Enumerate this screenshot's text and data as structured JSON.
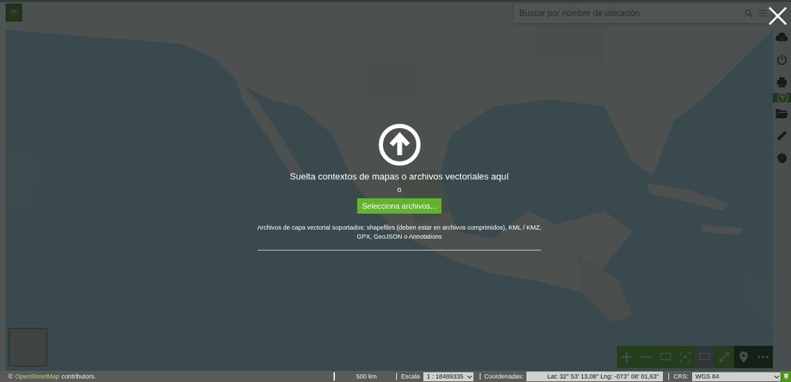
{
  "search": {
    "placeholder": "Buscar por nombre de ubicación"
  },
  "sidebar": {
    "items": [
      {
        "kind": "cloud",
        "selected": false
      },
      {
        "kind": "power",
        "selected": false
      },
      {
        "kind": "print",
        "selected": false
      },
      {
        "kind": "upload",
        "selected": true
      },
      {
        "kind": "folder",
        "selected": false
      },
      {
        "kind": "ruler",
        "selected": false
      },
      {
        "kind": "gear",
        "selected": false
      }
    ]
  },
  "map_toolbar": [
    {
      "kind": "plus",
      "disabled": false
    },
    {
      "kind": "minus",
      "disabled": false
    },
    {
      "kind": "extent",
      "disabled": false
    },
    {
      "kind": "fit",
      "disabled": false
    },
    {
      "kind": "frame",
      "disabled": true
    },
    {
      "kind": "fullscreen",
      "disabled": false
    },
    {
      "kind": "pin",
      "disabled": false
    },
    {
      "kind": "more",
      "disabled": false
    }
  ],
  "drop_zone": {
    "title": "Suelta contextos de mapas o archivos vectoriales aquí",
    "or_text": "o",
    "button": "Selecciona archivos...",
    "note": "Archivos de capa vectorial soportados: shapefiles (deben estar en archivos comprimidos), KML / KMZ, GPX, GeoJSON o Annotations"
  },
  "footer": {
    "attribution_prefix": "©",
    "attribution_link": "OpenStreetMap",
    "attribution_suffix": "contributors.",
    "scale_bar": "500 km",
    "scale_label": "Escala",
    "scale_value": "1 : 18489335",
    "coords_label": "Coordenadas:",
    "coords_value": "Lat: 32° 53' 13,08\" Lng: -073° 08' 01,63\"",
    "crs_label": "CRS:",
    "crs_value": "WGS 84"
  }
}
